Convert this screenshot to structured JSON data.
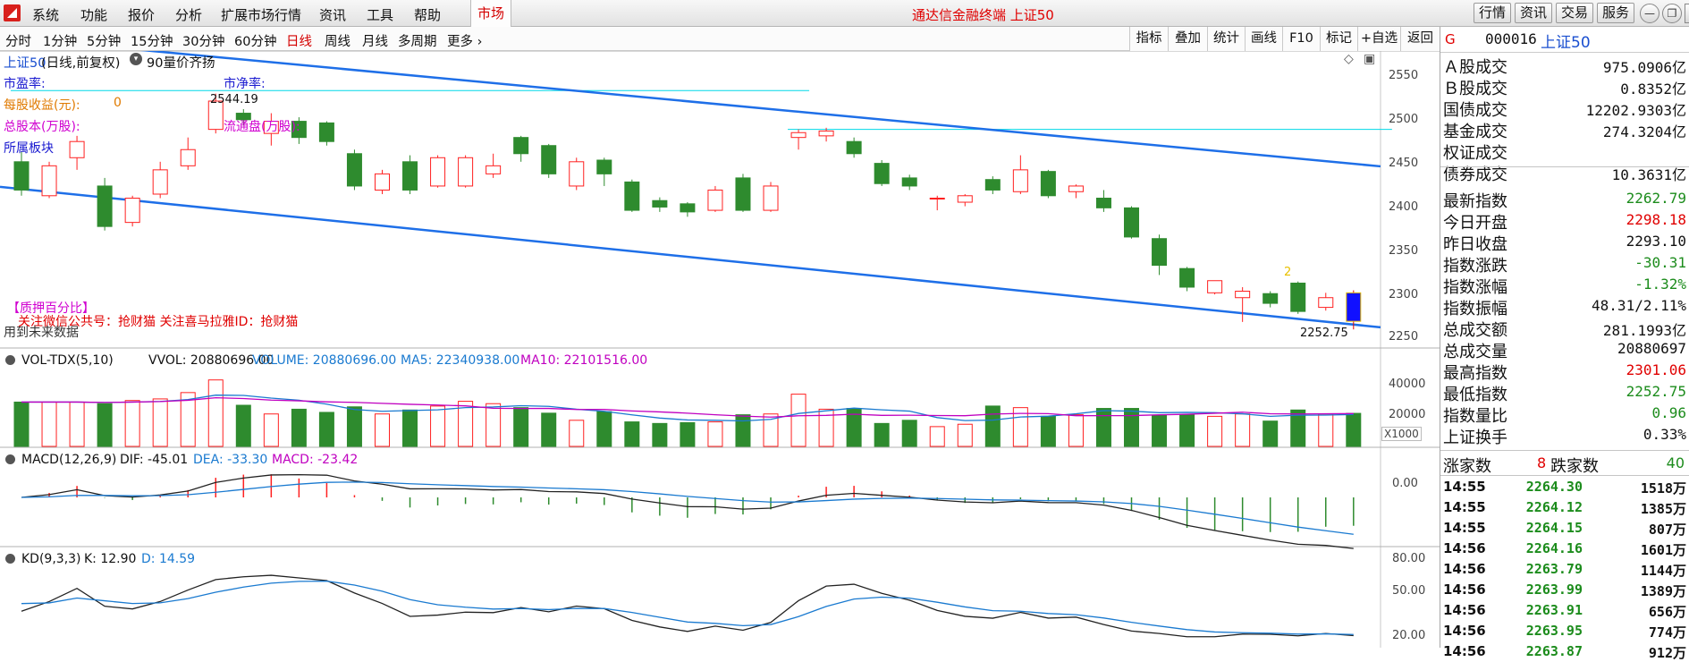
{
  "menubar": {
    "items": [
      "系统",
      "功能",
      "报价",
      "分析",
      "扩展市场行情",
      "资讯",
      "工具",
      "帮助"
    ],
    "market_tab": "市场",
    "app_title": "通达信金融终端  上证50",
    "right_buttons": [
      "行情",
      "资讯",
      "交易",
      "服务"
    ],
    "window_controls": [
      "minimize-icon",
      "restore-icon",
      "close-icon"
    ]
  },
  "periodbar": {
    "items": [
      "分时",
      "1分钟",
      "5分钟",
      "15分钟",
      "30分钟",
      "60分钟",
      "日线",
      "周线",
      "月线",
      "多周期",
      "更多 ›"
    ],
    "active": "日线",
    "right_buttons": [
      "指标",
      "叠加",
      "统计",
      "画线",
      "F10",
      "标记",
      "+自选",
      "返回"
    ]
  },
  "main_chart": {
    "title": "上证50",
    "mode": "(日线,前复权)",
    "option": "90量价齐扬",
    "info_labels": {
      "pe": "市盈率:",
      "pb": "市净率:",
      "eps": "每股收益(元):",
      "eps_value": "0",
      "total_shares": "总股本(万股):",
      "float_shares": "流通盘(万股):",
      "sector": "所属板块"
    },
    "pledge_label": "【质押百分比】",
    "promo": "关注微信公共号：抢财猫   关注喜马拉雅ID：抢财猫",
    "future_data_note": "用到未来数据",
    "high_marker": "2544.19",
    "low_marker": "2252.75",
    "count_marker": "2",
    "y_ticks": [
      "2550",
      "2500",
      "2450",
      "2400",
      "2350",
      "2300",
      "2250"
    ],
    "candles": [
      [
        2460,
        2425,
        2473,
        2418
      ],
      [
        2418,
        2455,
        2460,
        2415
      ],
      [
        2465,
        2485,
        2492,
        2450
      ],
      [
        2430,
        2380,
        2440,
        2375
      ],
      [
        2385,
        2415,
        2418,
        2380
      ],
      [
        2420,
        2450,
        2460,
        2415
      ],
      [
        2455,
        2475,
        2490,
        2450
      ],
      [
        2500,
        2535,
        2544.19,
        2495
      ],
      [
        2520,
        2512,
        2525,
        2505
      ],
      [
        2495,
        2510,
        2520,
        2480
      ],
      [
        2510,
        2490,
        2515,
        2482
      ],
      [
        2508,
        2485,
        2510,
        2480
      ],
      [
        2470,
        2430,
        2475,
        2425
      ],
      [
        2425,
        2445,
        2450,
        2420
      ],
      [
        2460,
        2425,
        2468,
        2420
      ],
      [
        2430,
        2465,
        2468,
        2428
      ],
      [
        2430,
        2465,
        2468,
        2428
      ],
      [
        2445,
        2455,
        2470,
        2440
      ],
      [
        2490,
        2470,
        2492,
        2460
      ],
      [
        2480,
        2445,
        2482,
        2440
      ],
      [
        2430,
        2460,
        2465,
        2425
      ],
      [
        2462,
        2445,
        2465,
        2430
      ],
      [
        2435,
        2400,
        2438,
        2398
      ],
      [
        2412,
        2404,
        2416,
        2398
      ],
      [
        2408,
        2398,
        2410,
        2392
      ],
      [
        2400,
        2425,
        2430,
        2398
      ],
      [
        2440,
        2400,
        2445,
        2398
      ],
      [
        2400,
        2430,
        2435,
        2398
      ],
      [
        2490,
        2496,
        2500,
        2475
      ],
      [
        2492,
        2498,
        2502,
        2485
      ],
      [
        2485,
        2470,
        2490,
        2465
      ],
      [
        2458,
        2433,
        2462,
        2430
      ],
      [
        2440,
        2430,
        2444,
        2425
      ],
      [
        2415,
        2415,
        2418,
        2400
      ],
      [
        2410,
        2418,
        2420,
        2405
      ],
      [
        2438,
        2425,
        2442,
        2420
      ],
      [
        2423,
        2450,
        2468,
        2420
      ],
      [
        2448,
        2418,
        2450,
        2415
      ],
      [
        2423,
        2430,
        2432,
        2415
      ],
      [
        2415,
        2403,
        2425,
        2398
      ],
      [
        2403,
        2367,
        2405,
        2365
      ],
      [
        2365,
        2332,
        2370,
        2320
      ],
      [
        2328,
        2305,
        2330,
        2300
      ],
      [
        2298,
        2313,
        2313,
        2296
      ],
      [
        2292,
        2300,
        2305,
        2262
      ],
      [
        2297,
        2285,
        2300,
        2280
      ],
      [
        2310,
        2275,
        2312,
        2272
      ],
      [
        2280,
        2292,
        2298,
        2276
      ],
      [
        2298,
        2262.79,
        2301.06,
        2252.75
      ]
    ],
    "upper_channel": [
      2515,
      2430
    ],
    "lower_channel": [
      2398,
      2262
    ],
    "cyan_lines": [
      {
        "x": [
          0,
          28
        ],
        "y": 2548
      },
      {
        "x": [
          28,
          49
        ],
        "y": 2500
      }
    ],
    "y_range": [
      2232,
      2577
    ]
  },
  "volume_panel": {
    "title": "VOL-TDX(5,10)",
    "vvol": "VVOL: 20880696.00",
    "volume": "VOLUME: 20880696.00",
    "ma5": "MA5: 22340938.00",
    "ma10": "MA10: 22101516.00",
    "y_ticks": [
      "40000",
      "20000"
    ],
    "unit": "X1000",
    "values": [
      28000,
      28000,
      28000,
      27000,
      29000,
      30000,
      34000,
      42000,
      26000,
      20500,
      23500,
      21500,
      25000,
      20500,
      23000,
      25500,
      28500,
      27000,
      24500,
      21000,
      16500,
      22000,
      15500,
      14500,
      15000,
      15500,
      20000,
      20500,
      33000,
      23500,
      24000,
      14500,
      16500,
      12500,
      14000,
      25500,
      24500,
      19000,
      20000,
      24000,
      24000,
      19500,
      20000,
      19000,
      20500,
      16000,
      23000,
      20500,
      20880
    ]
  },
  "macd_panel": {
    "title": "MACD(12,26,9)",
    "dif": "DIF: -45.01",
    "dea": "DEA: -33.30",
    "macd": "MACD: -23.42",
    "y_ticks": [
      "0.00"
    ]
  },
  "kd_panel": {
    "title": "KD(9,3,3)",
    "k": "K: 12.90",
    "d": "D: 14.59",
    "y_ticks": [
      "80.00",
      "50.00",
      "20.00"
    ]
  },
  "quote": {
    "code_badge": "G",
    "code": "000016",
    "name": "上证50",
    "rows": [
      {
        "label": "Ａ股成交",
        "value": "975.0906亿",
        "color": "#111111"
      },
      {
        "label": "Ｂ股成交",
        "value": "0.8352亿",
        "color": "#111111"
      },
      {
        "label": "国债成交",
        "value": "12202.9303亿",
        "color": "#111111"
      },
      {
        "label": "基金成交",
        "value": "274.3204亿",
        "color": "#111111"
      },
      {
        "label": "权证成交",
        "value": "",
        "color": "#111111"
      },
      {
        "label": "债券成交",
        "value": "10.3631亿",
        "color": "#111111"
      },
      {
        "label": "最新指数",
        "value": "2262.79",
        "color": "#1c8c1c"
      },
      {
        "label": "今日开盘",
        "value": "2298.18",
        "color": "#e00000"
      },
      {
        "label": "昨日收盘",
        "value": "2293.10",
        "color": "#111111"
      },
      {
        "label": "指数涨跌",
        "value": "-30.31",
        "color": "#1c8c1c"
      },
      {
        "label": "指数涨幅",
        "value": "-1.32%",
        "color": "#1c8c1c"
      },
      {
        "label": "指数振幅",
        "value": "48.31/2.11%",
        "color": "#111111"
      },
      {
        "label": "总成交额",
        "value": "281.1993亿",
        "color": "#111111"
      },
      {
        "label": "总成交量",
        "value": "20880697",
        "color": "#111111"
      },
      {
        "label": "最高指数",
        "value": "2301.06",
        "color": "#e00000"
      },
      {
        "label": "最低指数",
        "value": "2252.75",
        "color": "#1c8c1c"
      },
      {
        "label": "指数量比",
        "value": "0.96",
        "color": "#1c8c1c"
      },
      {
        "label": "上证换手",
        "value": "0.33%",
        "color": "#111111"
      }
    ],
    "up_label": "涨家数",
    "up_count": "8",
    "down_label": "跌家数",
    "down_count": "40",
    "ticks": [
      {
        "time": "14:55",
        "price": "2264.30",
        "vol": "1518万"
      },
      {
        "time": "14:55",
        "price": "2264.12",
        "vol": "1385万"
      },
      {
        "time": "14:55",
        "price": "2264.15",
        "vol": "807万"
      },
      {
        "time": "14:56",
        "price": "2264.16",
        "vol": "1601万"
      },
      {
        "time": "14:56",
        "price": "2263.79",
        "vol": "1144万"
      },
      {
        "time": "14:56",
        "price": "2263.99",
        "vol": "1389万"
      },
      {
        "time": "14:56",
        "price": "2263.91",
        "vol": "656万"
      },
      {
        "time": "14:56",
        "price": "2263.95",
        "vol": "774万"
      },
      {
        "time": "14:56",
        "price": "2263.87",
        "vol": "912万"
      }
    ]
  },
  "colors": {
    "up": "#ff2020",
    "down": "#2e8b2e",
    "channel": "#1e6fe8",
    "cyan": "#00d8e8",
    "last_bar": "#1010ff"
  }
}
